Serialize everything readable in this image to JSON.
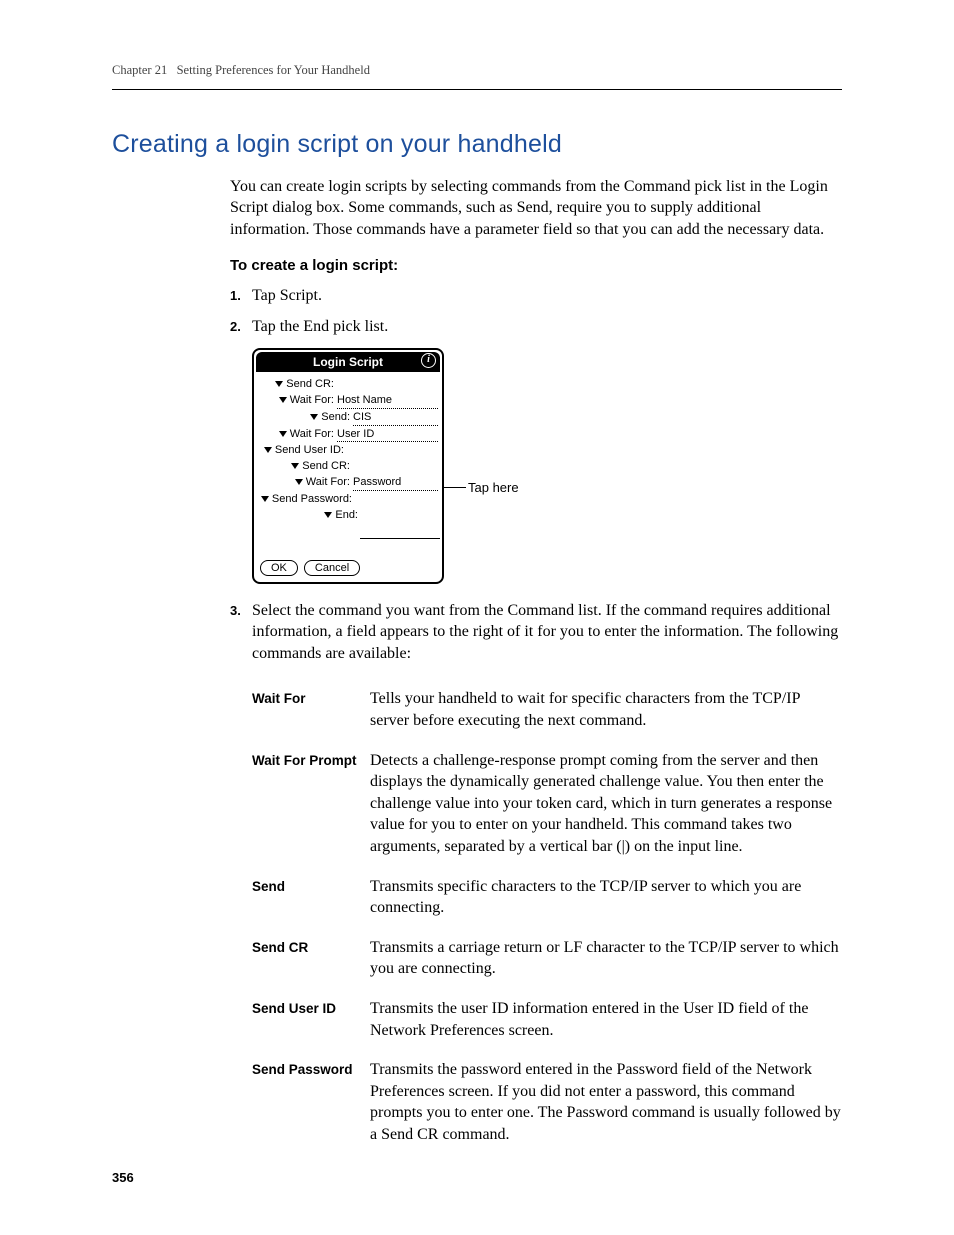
{
  "header": {
    "chapter": "Chapter 21",
    "chapter_title": "Setting Preferences for Your Handheld"
  },
  "title": "Creating a login script on your handheld",
  "intro": "You can create login scripts by selecting commands from the Command pick list in the Login Script dialog box. Some commands, such as Send, require you to supply additional information. Those commands have a parameter field so that you can add the necessary data.",
  "procedure_heading": "To create a login script:",
  "steps": {
    "s1": "Tap Script.",
    "s2": "Tap the End pick list.",
    "s3": "Select the command you want from the Command list. If the command requires additional information, a field appears to the right of it for you to enter the information. The following commands are available:"
  },
  "palm": {
    "title": "Login Script",
    "rows": [
      {
        "label": "Send CR:",
        "value": ""
      },
      {
        "label": "Wait For:",
        "value": "Host Name"
      },
      {
        "label": "Send:",
        "value": "CIS"
      },
      {
        "label": "Wait For:",
        "value": "User ID"
      },
      {
        "label": "Send User ID:",
        "value": ""
      },
      {
        "label": "Send CR:",
        "value": ""
      },
      {
        "label": "Wait For:",
        "value": "Password"
      },
      {
        "label": "Send Password:",
        "value": ""
      },
      {
        "label": "End:",
        "value": ""
      }
    ],
    "ok": "OK",
    "cancel": "Cancel"
  },
  "callout": "Tap here",
  "commands": [
    {
      "name": "Wait For",
      "desc": "Tells your handheld to wait for specific characters from the TCP/IP server before executing the next command."
    },
    {
      "name": "Wait For Prompt",
      "desc": "Detects a challenge-response prompt coming from the server and then displays the dynamically generated challenge value. You then enter the challenge value into your token card, which in turn generates a response value for you to enter on your handheld. This command takes two arguments, separated by a vertical bar (|) on the input line."
    },
    {
      "name": "Send",
      "desc": "Transmits specific characters to the TCP/IP server to which you are connecting."
    },
    {
      "name": "Send CR",
      "desc": "Transmits a carriage return or LF character to the TCP/IP server to which you are connecting."
    },
    {
      "name": "Send User ID",
      "desc": "Transmits the user ID information entered in the User ID field of the Network Preferences screen."
    },
    {
      "name": "Send Password",
      "desc": "Transmits the password entered in the Password field of the Network Preferences screen. If you did not enter a password, this command prompts you to enter one. The Password command is usually followed by a Send CR command."
    }
  ],
  "page_number": "356"
}
